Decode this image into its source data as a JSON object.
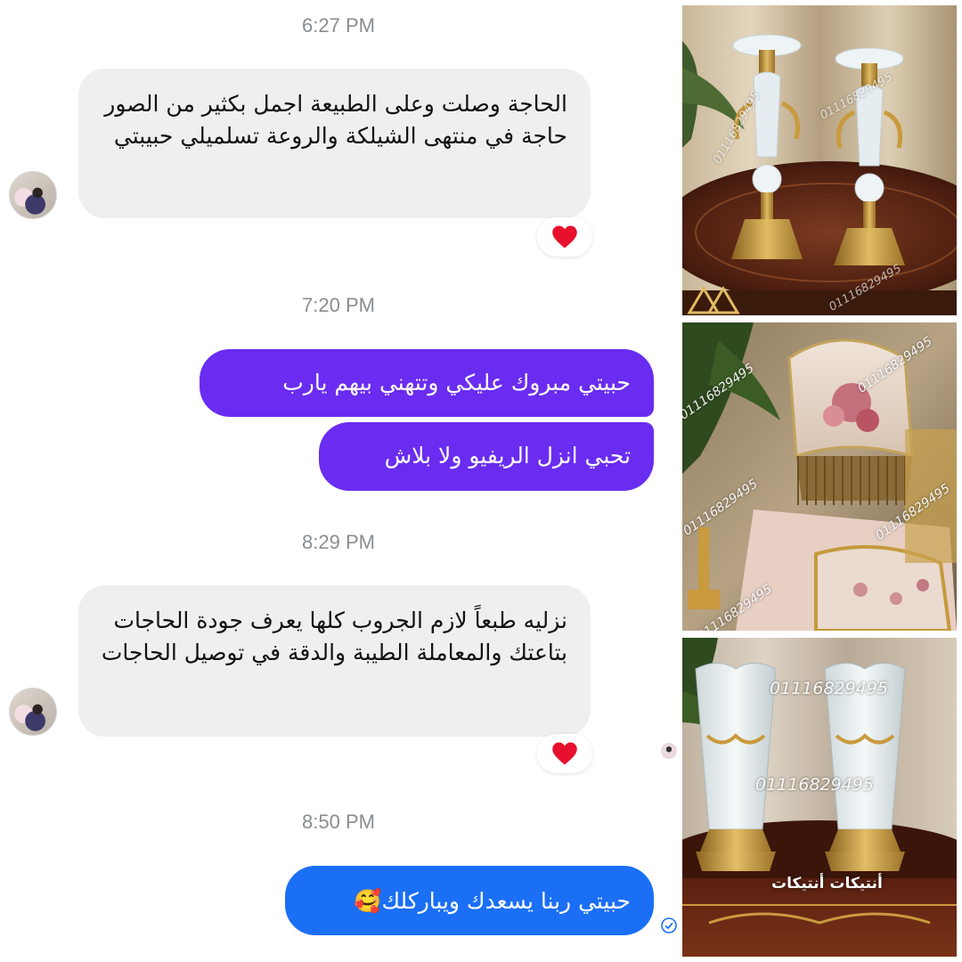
{
  "conversation": {
    "messages": [
      {
        "time": "6:27 PM",
        "direction": "incoming",
        "text": "الحاجة وصلت وعلى الطبيعة اجمل بكثير من الصور حاجة في منتهى الشيلكة والروعة تسلميلي حبيبتي",
        "reaction": "heart"
      },
      {
        "time": "7:20 PM",
        "direction": "outgoing",
        "text": "حبيتي مبروك عليكي وتتهني بيهم يارب"
      },
      {
        "direction": "outgoing",
        "text": "تحبي انزل الريفيو ولا بلاش"
      },
      {
        "time": "8:29 PM",
        "direction": "incoming",
        "text": "نزليه طبعاً لازم الجروب كلها يعرف جودة الحاجات بتاعتك والمعاملة الطيبة والدقة في توصيل الحاجات",
        "reaction": "heart"
      },
      {
        "time": "8:50 PM",
        "direction": "outgoing",
        "text": "حبيتي ربنا يسعدك ويباركلك🥰"
      }
    ],
    "colors": {
      "outgoing_purple": "#6a2cf0",
      "outgoing_blue": "#1b6ff5",
      "incoming": "#efeff0",
      "reaction_heart": "#e8112d"
    }
  },
  "photos": {
    "phone_watermark": "01116829495",
    "shop_name": "أنتيكات أنتيكات"
  }
}
